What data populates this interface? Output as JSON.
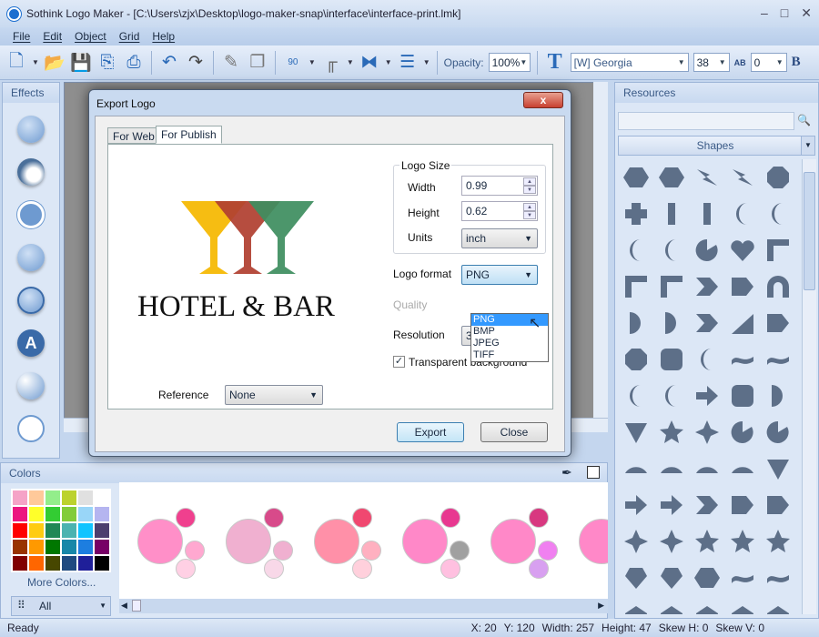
{
  "window": {
    "title": "Sothink Logo Maker - [C:\\Users\\zjx\\Desktop\\logo-maker-snap\\interface\\interface-print.lmk]"
  },
  "menu": [
    "File",
    "Edit",
    "Object",
    "Grid",
    "Help"
  ],
  "toolbar": {
    "opacity_label": "Opacity:",
    "opacity_value": "100%",
    "font_value": "[W]   Georgia",
    "font_size": "38",
    "spacing": "0",
    "rotate_label": "90",
    "bold": "B"
  },
  "effects": {
    "title": "Effects"
  },
  "resources": {
    "title": "Resources",
    "category": "Shapes",
    "search_value": "",
    "shapes": [
      "hexagon",
      "hexagon-wide",
      "bolt",
      "bolt2",
      "octagon",
      "cross",
      "pill-v",
      "capsule",
      "arc",
      "crescent",
      "moon",
      "moon2",
      "circle-cut",
      "heart",
      "corner",
      "corner-l",
      "corner-r",
      "chevron",
      "pentagon-arrow",
      "arch",
      "half-circle",
      "d-shape",
      "chevron2",
      "ramp",
      "trapezoid-cut",
      "octagon",
      "rounded-rect",
      "bracket",
      "wave-flag",
      "wave-flag2",
      "arc-shape",
      "curve-shape",
      "arrow-turn",
      "rounded-square",
      "quarter",
      "triangle-down",
      "star8",
      "star4",
      "pacman",
      "pacman2",
      "fan",
      "dome",
      "fan2",
      "fan3",
      "shield-tri",
      "arrow",
      "arrow2",
      "arrow3",
      "arrow4",
      "arrow5",
      "tri-star",
      "star4b",
      "star5",
      "star6",
      "star8b",
      "gem",
      "banner",
      "hex-pot",
      "tilde",
      "wave",
      "house",
      "house2",
      "house3",
      "house4",
      "house5"
    ]
  },
  "colors": {
    "title": "Colors",
    "more_label": "More Colors...",
    "filter_value": "All",
    "swatches": [
      "#f5a3c7",
      "#ffc99a",
      "#93ee8b",
      "#bcd22e",
      "#e0e0e0",
      "#ffffff",
      "#ec1680",
      "#ffff2a",
      "#33cc33",
      "#82cc3a",
      "#99d6f8",
      "#b5b5f0",
      "#ff0000",
      "#ffcc11",
      "#208855",
      "#4bb3b0",
      "#11c4ff",
      "#4c3f6e",
      "#993300",
      "#ff9900",
      "#007700",
      "#1887a8",
      "#1d7ee0",
      "#770066",
      "#800000",
      "#ff6600",
      "#474700",
      "#1f4a80",
      "#1f1f99",
      "#000000"
    ],
    "schemes": [
      {
        "big": "#ff8fc8",
        "top": "#f0408e",
        "mid": "#ffa8d0",
        "bottom": "#ffd0e4"
      },
      {
        "big": "#f0b0d0",
        "top": "#d84a8a",
        "mid": "#f0b0d0",
        "bottom": "#f8d8e8"
      },
      {
        "big": "#ff90a8",
        "top": "#f04870",
        "mid": "#ffb0c0",
        "bottom": "#ffd0dc"
      },
      {
        "big": "#ff88c8",
        "top": "#e83890",
        "mid": "#a0a0a0",
        "bottom": "#ffc0e0"
      },
      {
        "big": "#ff88c8",
        "top": "#d83880",
        "mid": "#f080f0",
        "bottom": "#d8a0f0"
      },
      {
        "big": "#ff88c8",
        "top": "#e83890",
        "mid": "#ffa8d0",
        "bottom": "#ffd0e4"
      }
    ]
  },
  "dialog": {
    "title": "Export Logo",
    "close": "x",
    "tabs": [
      "For Web",
      "For Publish"
    ],
    "active_tab": "For Publish",
    "logo_text": "HOTEL & BAR",
    "logo_colors": [
      "#f5b800",
      "#b04030",
      "#3e8e60"
    ],
    "logo_size_label": "Logo Size",
    "width_label": "Width",
    "width_value": "0.99",
    "height_label": "Height",
    "height_value": "0.62",
    "units_label": "Units",
    "units_value": "inch",
    "format_label": "Logo format",
    "format_value": "PNG",
    "format_options": [
      "PNG",
      "BMP",
      "JPEG",
      "TIFF"
    ],
    "quality_label": "Quality",
    "resolution_label": "Resolution",
    "resolution_value": "300",
    "transparent_label": "Transparent background",
    "transparent_checked": true,
    "reference_label": "Reference",
    "reference_value": "None",
    "export_label": "Export",
    "close_label": "Close"
  },
  "status": {
    "ready": "Ready",
    "x": "X: 20",
    "y": "Y: 120",
    "width": "Width: 257",
    "height": "Height: 47",
    "skew_h": "Skew H: 0",
    "skew_v": "Skew V: 0"
  }
}
